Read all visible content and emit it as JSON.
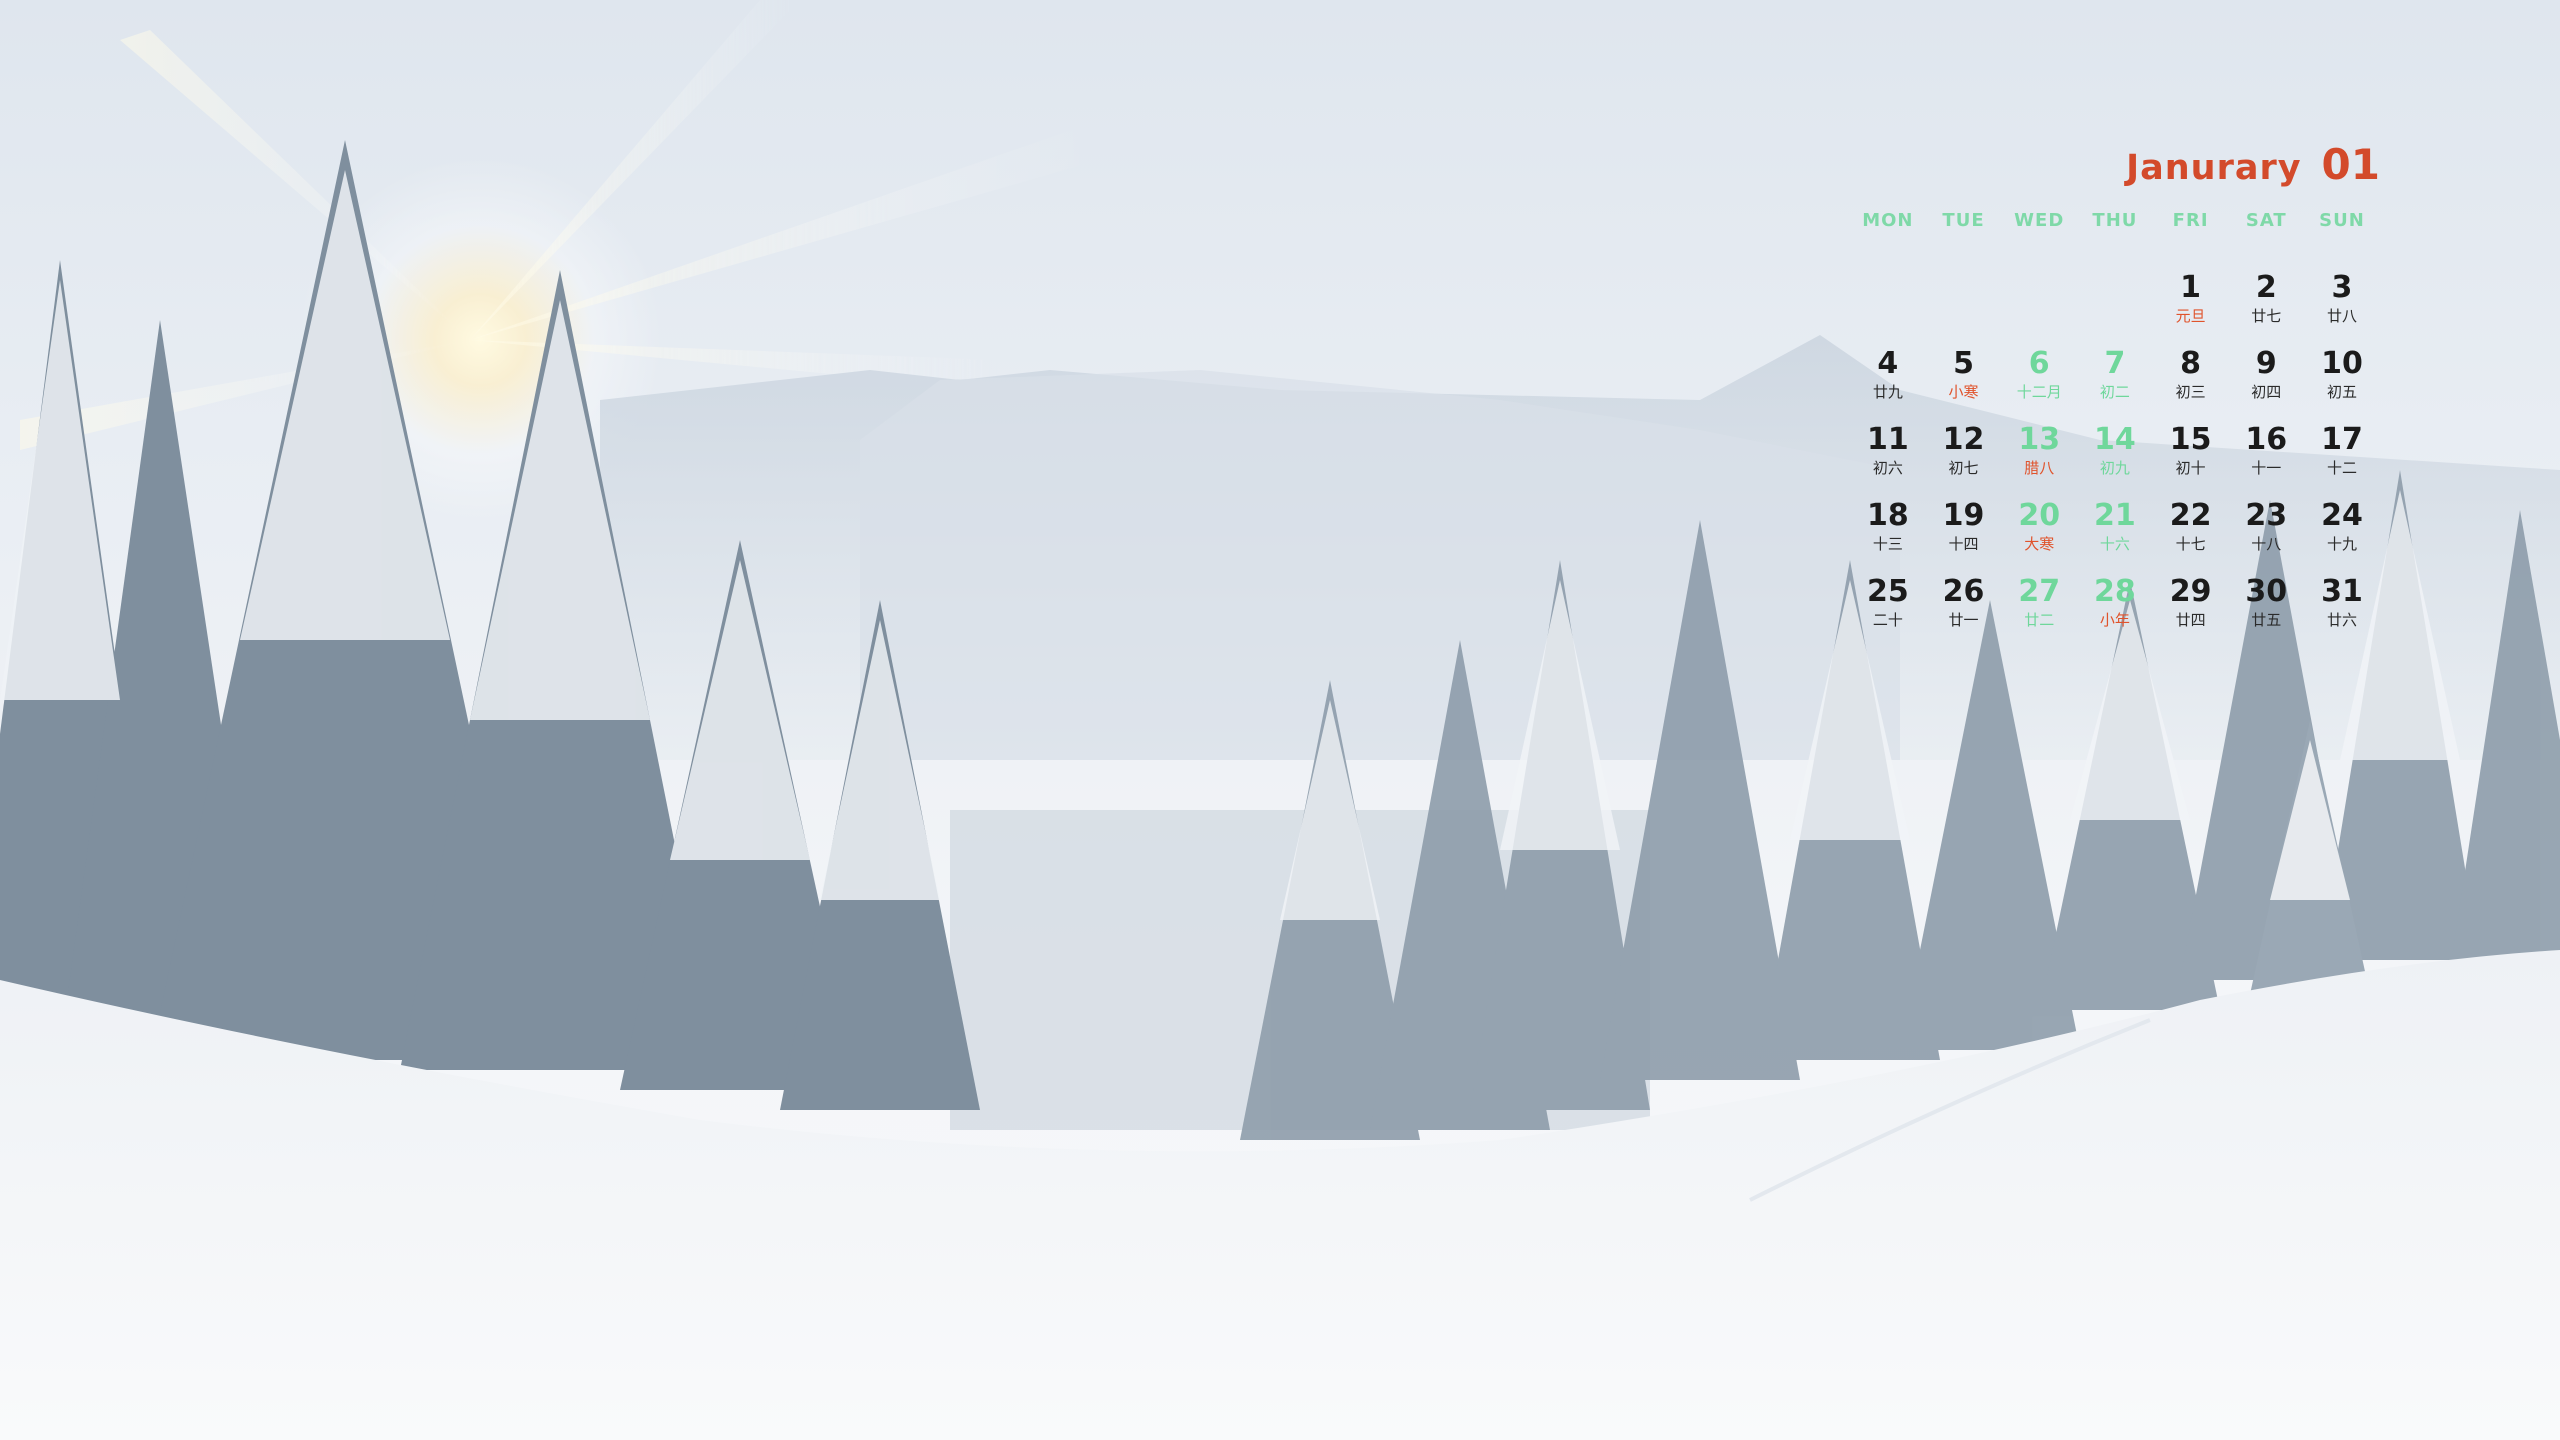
{
  "calendar": {
    "month_name": "Janurary",
    "month_number": "01",
    "weekdays": [
      "MON",
      "TUE",
      "WED",
      "THU",
      "FRI",
      "SAT",
      "SUN"
    ],
    "days": [
      {
        "day": "1",
        "lunar": "元旦",
        "festival": true
      },
      {
        "day": "2",
        "lunar": "廿七"
      },
      {
        "day": "3",
        "lunar": "廿八"
      },
      {
        "day": "4",
        "lunar": "廿九"
      },
      {
        "day": "5",
        "lunar": "小寒",
        "festival": true
      },
      {
        "day": "6",
        "lunar": "十二月",
        "weekend": true
      },
      {
        "day": "7",
        "lunar": "初二",
        "weekend": true
      },
      {
        "day": "8",
        "lunar": "初三"
      },
      {
        "day": "9",
        "lunar": "初四"
      },
      {
        "day": "10",
        "lunar": "初五"
      },
      {
        "day": "11",
        "lunar": "初六"
      },
      {
        "day": "12",
        "lunar": "初七"
      },
      {
        "day": "13",
        "lunar": "腊八",
        "weekend": true,
        "festival": true
      },
      {
        "day": "14",
        "lunar": "初九",
        "weekend": true
      },
      {
        "day": "15",
        "lunar": "初十"
      },
      {
        "day": "16",
        "lunar": "十一"
      },
      {
        "day": "17",
        "lunar": "十二"
      },
      {
        "day": "18",
        "lunar": "十三"
      },
      {
        "day": "19",
        "lunar": "十四"
      },
      {
        "day": "20",
        "lunar": "大寒",
        "weekend": true,
        "festival": true
      },
      {
        "day": "21",
        "lunar": "十六",
        "weekend": true
      },
      {
        "day": "22",
        "lunar": "十七"
      },
      {
        "day": "23",
        "lunar": "十八"
      },
      {
        "day": "24",
        "lunar": "十九"
      },
      {
        "day": "25",
        "lunar": "二十"
      },
      {
        "day": "26",
        "lunar": "廿一"
      },
      {
        "day": "27",
        "lunar": "廿二",
        "weekend": true
      },
      {
        "day": "28",
        "lunar": "小年",
        "weekend": true,
        "festival": true
      },
      {
        "day": "29",
        "lunar": "廿四"
      },
      {
        "day": "30",
        "lunar": "廿五"
      },
      {
        "day": "31",
        "lunar": "廿六"
      }
    ]
  },
  "colors": {
    "accent_red": "#d34a2b",
    "weekend_green": "#6fd79b",
    "sky": "#dfe6ee",
    "snow": "#f7f8fa"
  }
}
